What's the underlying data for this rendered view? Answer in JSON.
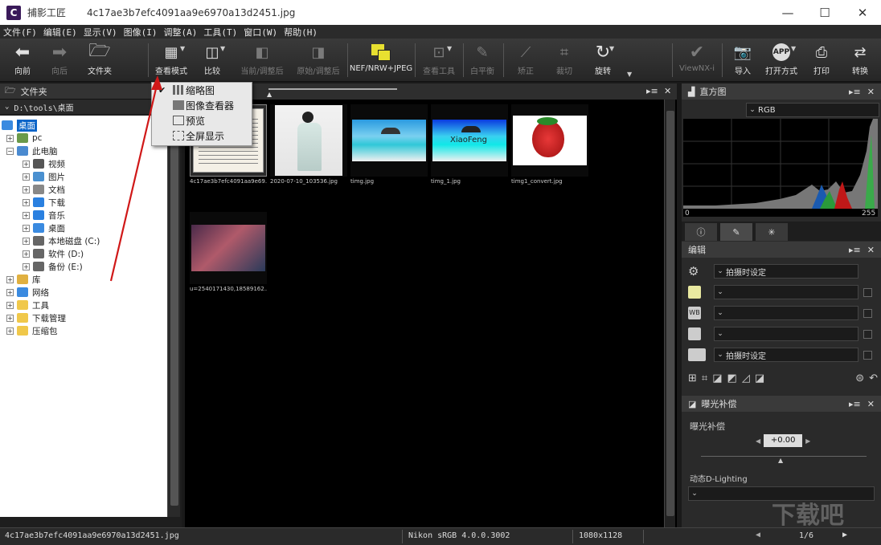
{
  "window": {
    "app_name": "捕影工匠",
    "file_title": "4c17ae3b7efc4091aa9e6970a13d2451.jpg",
    "minimize_icon": "—",
    "maximize_icon": "☐",
    "close_icon": "✕"
  },
  "menu": [
    "文件(F)",
    "编辑(E)",
    "显示(V)",
    "图像(I)",
    "调整(A)",
    "工具(T)",
    "窗口(W)",
    "帮助(H)"
  ],
  "toolbar": {
    "back": "向前",
    "forward": "向后",
    "folder": "文件夹",
    "view_mode": "查看模式",
    "compare": "比较",
    "current_adjusted": "当前/调整后",
    "original_adjusted": "原始/调整后",
    "nef": "NEF/NRW+JPEG",
    "view_tools": "查看工具",
    "white_balance": "白平衡",
    "straighten": "矫正",
    "crop": "裁切",
    "rotate": "旋转",
    "viewnx": "ViewNX-i",
    "import": "导入",
    "open_with": "打开方式",
    "print": "打印",
    "convert": "转换"
  },
  "view_menu": {
    "items": [
      "缩略图",
      "图像查看器",
      "预览",
      "全屏显示"
    ],
    "checked_index": 0
  },
  "folder_panel": {
    "title": "文件夹",
    "path": "D:\\tools\\桌面",
    "tree": [
      {
        "label": "桌面",
        "level": 0,
        "expander": "",
        "selected": true,
        "color": "#3a8ae0"
      },
      {
        "label": "pc",
        "level": 1,
        "expander": "+",
        "color": "#6a9a4a"
      },
      {
        "label": "此电脑",
        "level": 1,
        "expander": "−",
        "color": "#4a8ad0"
      },
      {
        "label": "视频",
        "level": 2,
        "expander": "+",
        "color": "#555"
      },
      {
        "label": "图片",
        "level": 2,
        "expander": "+",
        "color": "#4a90d0"
      },
      {
        "label": "文档",
        "level": 2,
        "expander": "+",
        "color": "#888"
      },
      {
        "label": "下载",
        "level": 2,
        "expander": "+",
        "color": "#2a80e0"
      },
      {
        "label": "音乐",
        "level": 2,
        "expander": "+",
        "color": "#2a80e0"
      },
      {
        "label": "桌面",
        "level": 2,
        "expander": "+",
        "color": "#3a8ae0"
      },
      {
        "label": "本地磁盘 (C:)",
        "level": 2,
        "expander": "+",
        "color": "#666"
      },
      {
        "label": "软件 (D:)",
        "level": 2,
        "expander": "+",
        "color": "#666"
      },
      {
        "label": "备份 (E:)",
        "level": 2,
        "expander": "+",
        "color": "#666"
      },
      {
        "label": "库",
        "level": 1,
        "expander": "+",
        "color": "#e0b040"
      },
      {
        "label": "网络",
        "level": 1,
        "expander": "+",
        "color": "#3a8ae0"
      },
      {
        "label": "工具",
        "level": 1,
        "expander": "+",
        "color": "#f0c84a"
      },
      {
        "label": "下载管理",
        "level": 1,
        "expander": "+",
        "color": "#f0c84a"
      },
      {
        "label": "压缩包",
        "level": 1,
        "expander": "+",
        "color": "#f0c84a"
      }
    ]
  },
  "thumbnails": [
    {
      "caption": "4c17ae3b7efc4091aa9e69...",
      "kind": "document",
      "selected": true
    },
    {
      "caption": "2020-07-10_103536.jpg",
      "kind": "portrait"
    },
    {
      "caption": "timg.jpg",
      "kind": "beach"
    },
    {
      "caption": "timg_1.jpg",
      "kind": "beach_text",
      "overlay": "XiaoFeng"
    },
    {
      "caption": "timg1_convert.jpg",
      "kind": "strawberry"
    },
    {
      "caption": "u=2540171430,18589162...",
      "kind": "anime"
    }
  ],
  "histogram": {
    "title": "直方图",
    "channel": "RGB",
    "min_label": "0",
    "max_label": "255"
  },
  "edit_panel": {
    "title": "编辑",
    "row1": "拍摄时设定",
    "row5": "拍摄时设定"
  },
  "exposure_panel": {
    "title": "曝光补偿",
    "label": "曝光补偿",
    "value": "+0.00",
    "dlighting_label": "动态D-Lighting"
  },
  "status": {
    "filename": "4c17ae3b7efc4091aa9e6970a13d2451.jpg",
    "profile": "Nikon sRGB 4.0.0.3002",
    "dimensions": "1080x1128",
    "page": "1/6"
  },
  "watermark": "下载吧"
}
